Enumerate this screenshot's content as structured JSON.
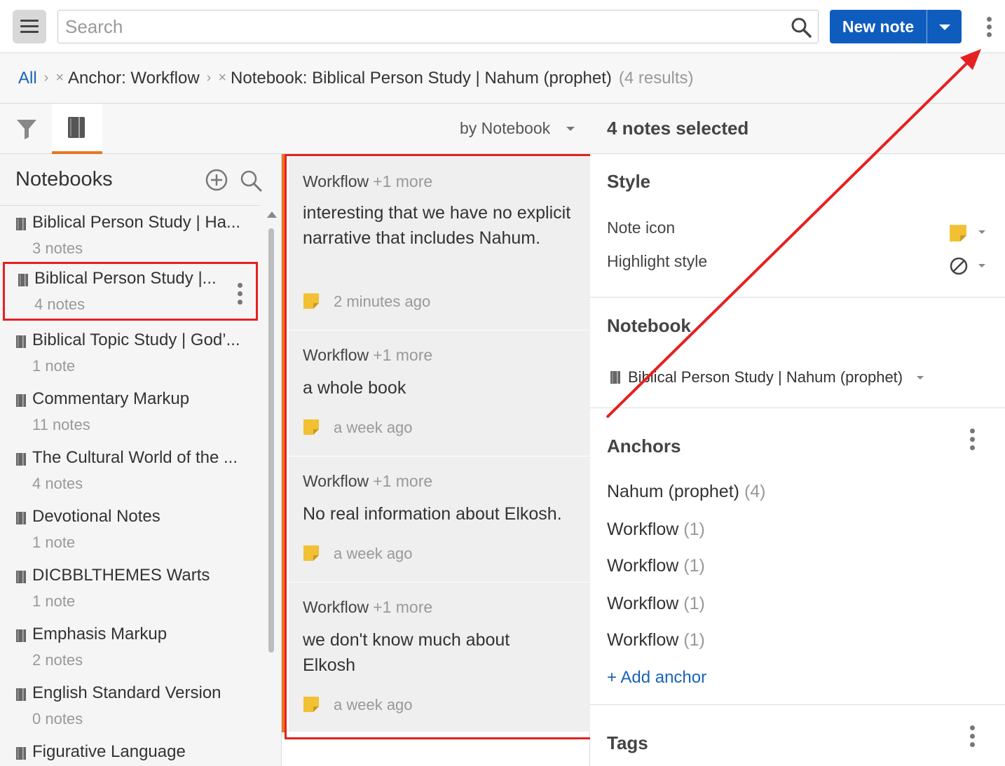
{
  "topbar": {
    "search_placeholder": "Search",
    "new_note_label": "New note",
    "icons": [
      "hamburger-icon",
      "search-icon",
      "chevron-down-icon",
      "kebab-icon"
    ]
  },
  "breadcrumb": {
    "all": "All",
    "items": [
      "Anchor: Workflow",
      "Notebook: Biblical Person Study | Nahum (prophet)"
    ],
    "result_count": "(4 results)"
  },
  "left": {
    "header_title": "Notebooks",
    "notebooks": [
      {
        "name": "Biblical Person Study | Ha...",
        "count": "3 notes"
      },
      {
        "name": "Biblical Person Study |...",
        "count": "4 notes",
        "selected": true
      },
      {
        "name": "Biblical Topic Study | God’...",
        "count": "1 note"
      },
      {
        "name": "Commentary Markup",
        "count": "11 notes"
      },
      {
        "name": "The Cultural World of the ...",
        "count": "4 notes"
      },
      {
        "name": "Devotional Notes",
        "count": "1 note"
      },
      {
        "name": "DICBBLTHEMES Warts",
        "count": "1 note"
      },
      {
        "name": "Emphasis Markup",
        "count": "2 notes"
      },
      {
        "name": "English Standard Version",
        "count": "0 notes"
      },
      {
        "name": "Figurative Language",
        "count": ""
      }
    ]
  },
  "middle": {
    "sort_label": "by Notebook",
    "notes": [
      {
        "anchor": "Workflow",
        "more": "+1 more",
        "text": "interesting that we have no explicit narrative that includes Nahum.",
        "time": "2 minutes ago"
      },
      {
        "anchor": "Workflow",
        "more": "+1 more",
        "text": "a whole book",
        "time": "a week ago"
      },
      {
        "anchor": "Workflow",
        "more": "+1 more",
        "text": "No real information about Elkosh.",
        "time": "a week ago"
      },
      {
        "anchor": "Workflow",
        "more": "+1 more",
        "text": "we don't know much about Elkosh",
        "time": "a week ago"
      }
    ]
  },
  "right": {
    "selected_title": "4 notes selected",
    "style_title": "Style",
    "note_icon_label": "Note icon",
    "highlight_style_label": "Highlight style",
    "notebook_title": "Notebook",
    "notebook_value": "Biblical Person Study | Nahum (prophet)",
    "anchors_title": "Anchors",
    "anchors": [
      {
        "name": "Nahum (prophet)",
        "count": "(4)"
      },
      {
        "name": "Workflow",
        "count": "(1)"
      },
      {
        "name": "Workflow",
        "count": "(1)"
      },
      {
        "name": "Workflow",
        "count": "(1)"
      },
      {
        "name": "Workflow",
        "count": "(1)"
      }
    ],
    "add_anchor": "+ Add anchor",
    "tags_title": "Tags"
  },
  "colors": {
    "accent": "#0f5cbf",
    "tab_active": "#e87722",
    "annotation_red": "#e62020",
    "sticky_note": "#f2c033"
  }
}
